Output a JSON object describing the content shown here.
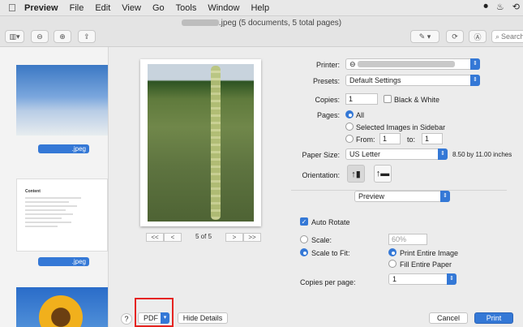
{
  "menubar": {
    "apple": "",
    "items": [
      "Preview",
      "File",
      "Edit",
      "View",
      "Go",
      "Tools",
      "Window",
      "Help"
    ]
  },
  "window": {
    "title_suffix": ".jpeg (5 documents, 5 total pages)",
    "search_placeholder": "Search"
  },
  "sidebar": {
    "thumb1_label": ".jpeg",
    "thumb2_title": "Content",
    "thumb2_label": ".jpeg"
  },
  "preview": {
    "page_label": "5 of 5"
  },
  "print": {
    "printer_label": "Printer:",
    "presets_label": "Presets:",
    "presets_value": "Default Settings",
    "copies_label": "Copies:",
    "copies_value": "1",
    "bw_label": "Black & White",
    "pages_label": "Pages:",
    "pages_all": "All",
    "pages_selected": "Selected Images in Sidebar",
    "pages_from": "From:",
    "from_value": "1",
    "pages_to": "to:",
    "to_value": "1",
    "paper_size_label": "Paper Size:",
    "paper_size_value": "US Letter",
    "paper_size_dims": "8.50 by 11.00 inches",
    "orientation_label": "Orientation:",
    "app_section": "Preview",
    "auto_rotate": "Auto Rotate",
    "scale_label": "Scale:",
    "scale_value": "60%",
    "scale_to_fit": "Scale to Fit:",
    "print_entire": "Print Entire Image",
    "fill_entire": "Fill Entire Paper",
    "copies_per_page_label": "Copies per page:",
    "copies_per_page_value": "1"
  },
  "footer": {
    "help": "?",
    "pdf": "PDF",
    "hide_details": "Hide Details",
    "cancel": "Cancel",
    "print": "Print"
  },
  "colors": {
    "accent": "#3478d6",
    "highlight_box": "#e52421"
  }
}
